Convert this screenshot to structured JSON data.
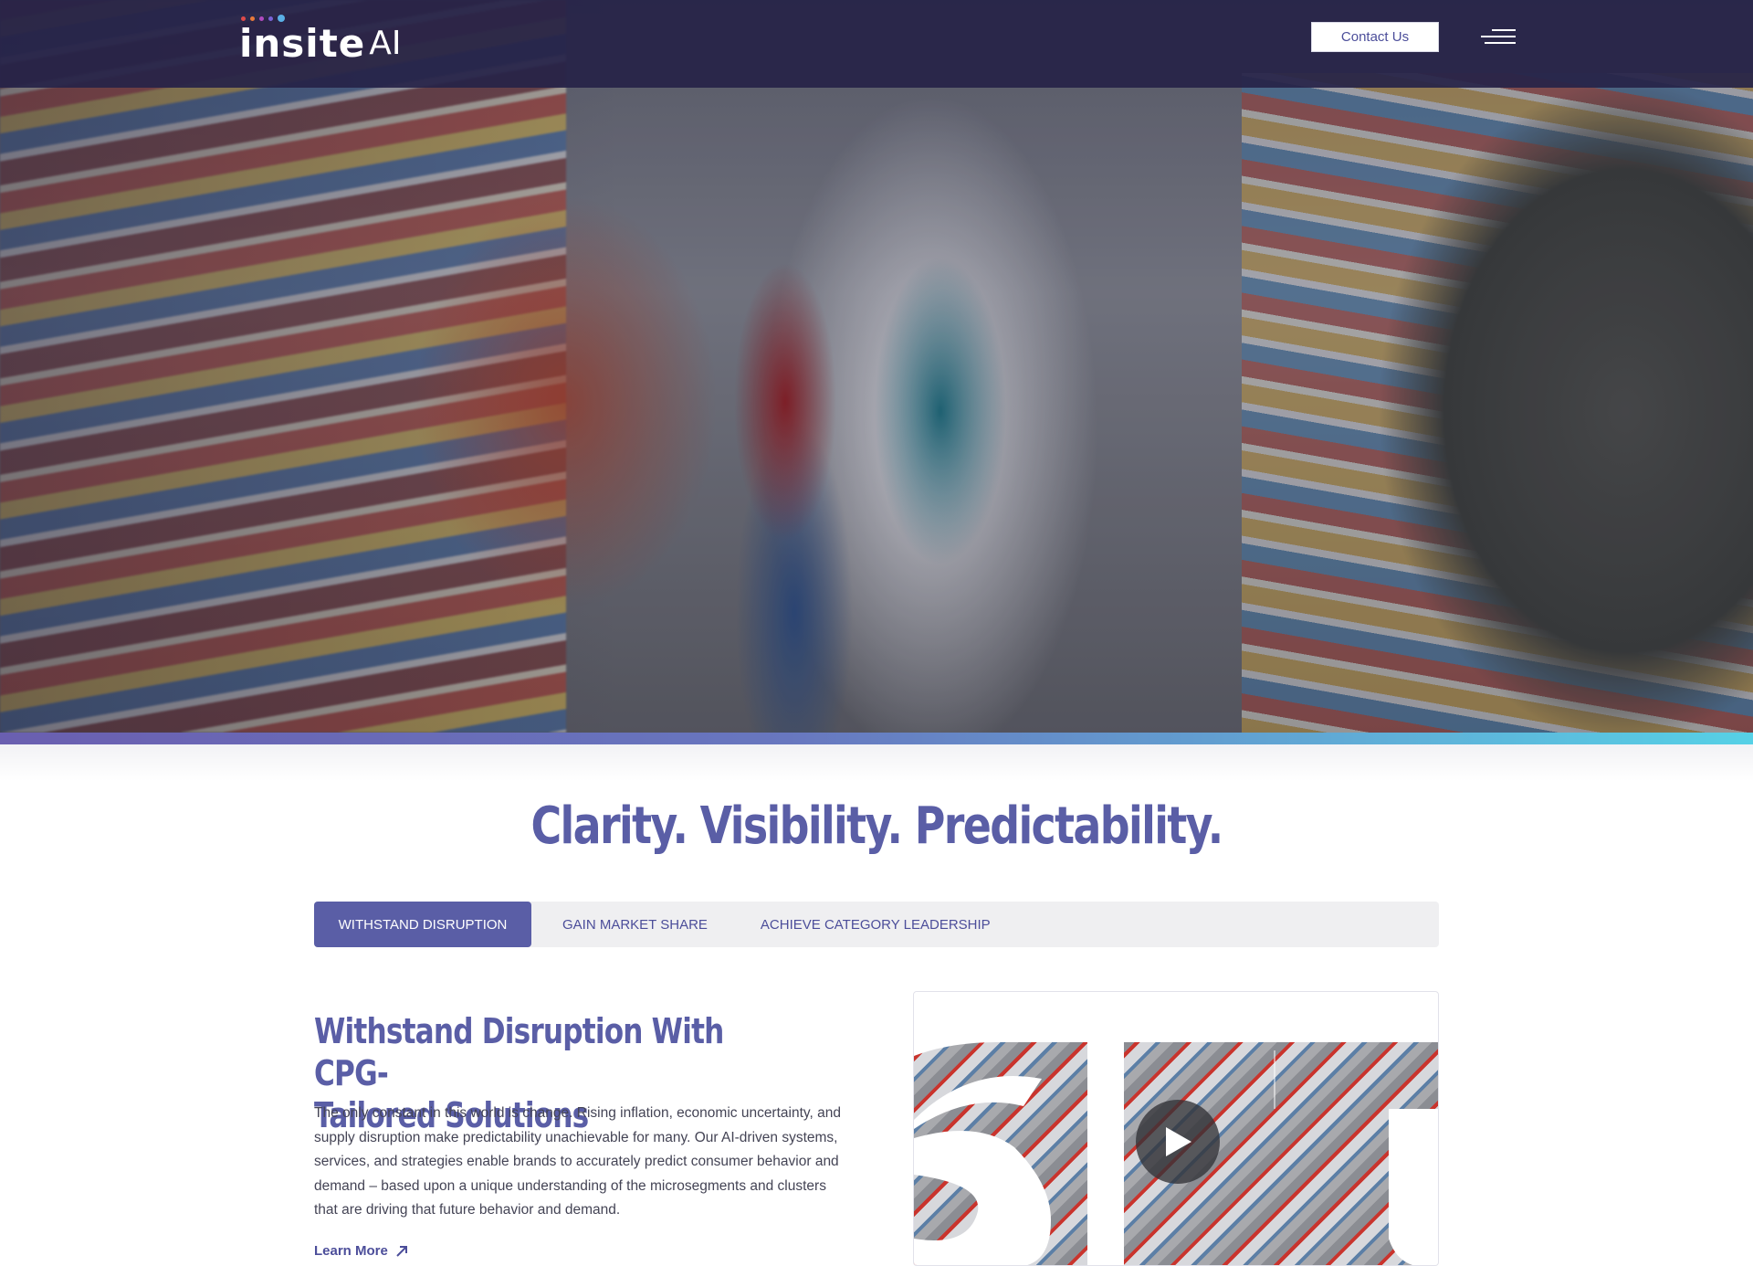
{
  "header": {
    "logo_main": "insite",
    "logo_suffix": "AI",
    "logo_dot_colors": [
      "#e04a4a",
      "#e97a3a",
      "#b04ac0",
      "#7a63d8",
      "#5ab0e6",
      "#6fd3f0"
    ],
    "contact_label": "Contact Us",
    "menu_icon": "hamburger-menu-icon"
  },
  "hero": {
    "image_description_icon": "hero-photo"
  },
  "colors": {
    "brand_purple": "#5a5ea6",
    "nav_bg": "#262348",
    "gradient_start": "#6a5fb0",
    "gradient_end": "#56d1e6"
  },
  "main": {
    "headline": "Clarity. Visibility. Predictability.",
    "tabs": [
      {
        "label": "WITHSTAND DISRUPTION",
        "active": true
      },
      {
        "label": "GAIN MARKET SHARE",
        "active": false
      },
      {
        "label": "ACHIEVE CATEGORY LEADERSHIP",
        "active": false
      }
    ],
    "section_title": "Withstand Disruption With CPG-Tailored Solutions",
    "section_title_line1": "Withstand Disruption With CPG-",
    "section_title_line2": "Tailored Solutions",
    "section_body": "The only constant in this world is change. Rising inflation, economic uncertainty, and supply disruption make predictability unachievable for many. Our AI-driven systems, services, and strategies enable brands to accurately predict consumer behavior and demand – based upon a unique understanding of the microsegments and clusters that are driving that future behavior and demand.",
    "learn_more_label": "Learn More",
    "learn_more_icon": "arrow-up-right-icon",
    "video_play_icon": "play-icon"
  }
}
